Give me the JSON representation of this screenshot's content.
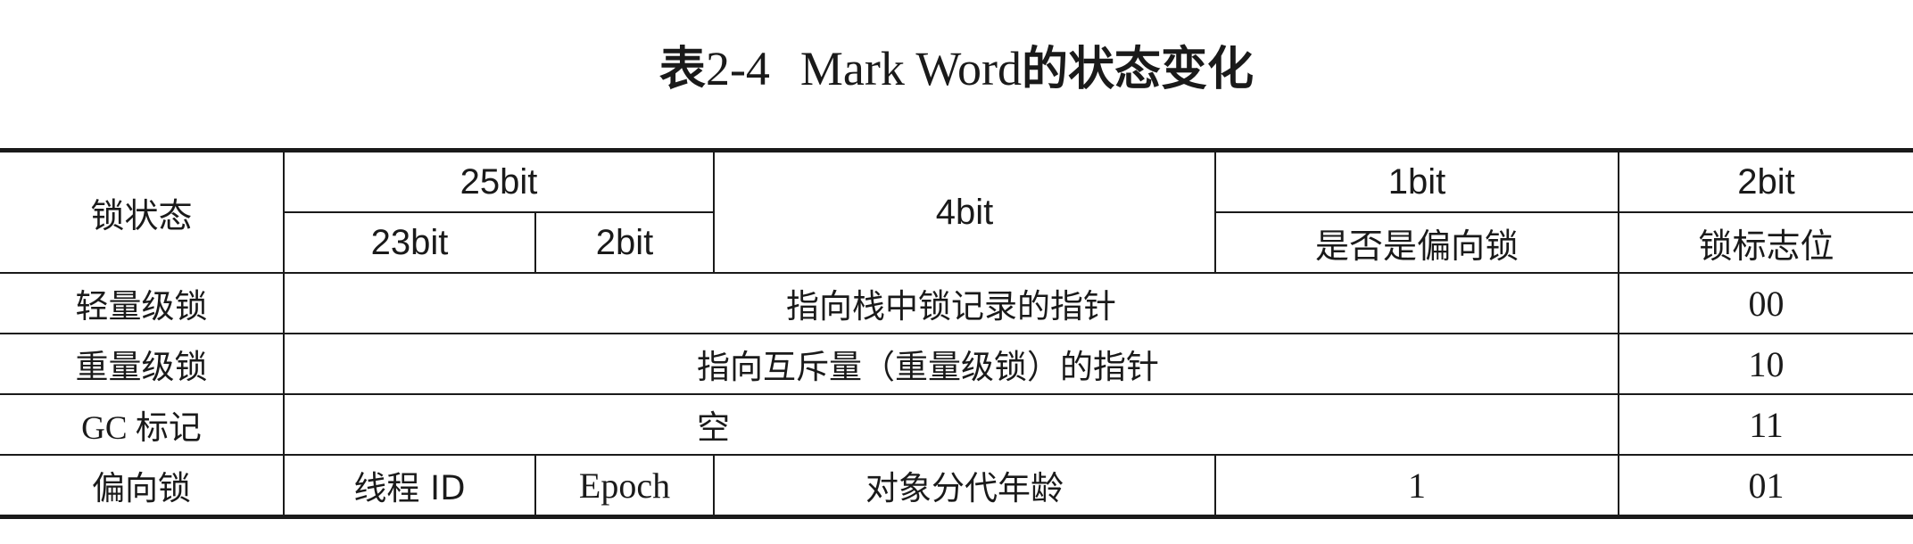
{
  "title": {
    "prefix": "表",
    "number": "2-4",
    "name_en": "Mark Word",
    "name_cn": "的状态变化"
  },
  "table": {
    "header": {
      "lock_state": "锁状态",
      "bits_25": "25bit",
      "bits_23": "23bit",
      "bits_2a": "2bit",
      "bits_4": "4bit",
      "bits_1": "1bit",
      "is_biased": "是否是偏向锁",
      "bits_2b": "2bit",
      "lock_flag": "锁标志位"
    },
    "rows": [
      {
        "state": "轻量级锁",
        "content": "指向栈中锁记录的指针",
        "flag": "00"
      },
      {
        "state": "重量级锁",
        "content": "指向互斥量（重量级锁）的指针",
        "flag": "10"
      },
      {
        "state": "GC 标记",
        "content": "空",
        "flag": "11"
      }
    ],
    "biased_row": {
      "state": "偏向锁",
      "thread_id": "线程 ID",
      "epoch": "Epoch",
      "age": "对象分代年龄",
      "biased_bit": "1",
      "flag": "01"
    }
  }
}
